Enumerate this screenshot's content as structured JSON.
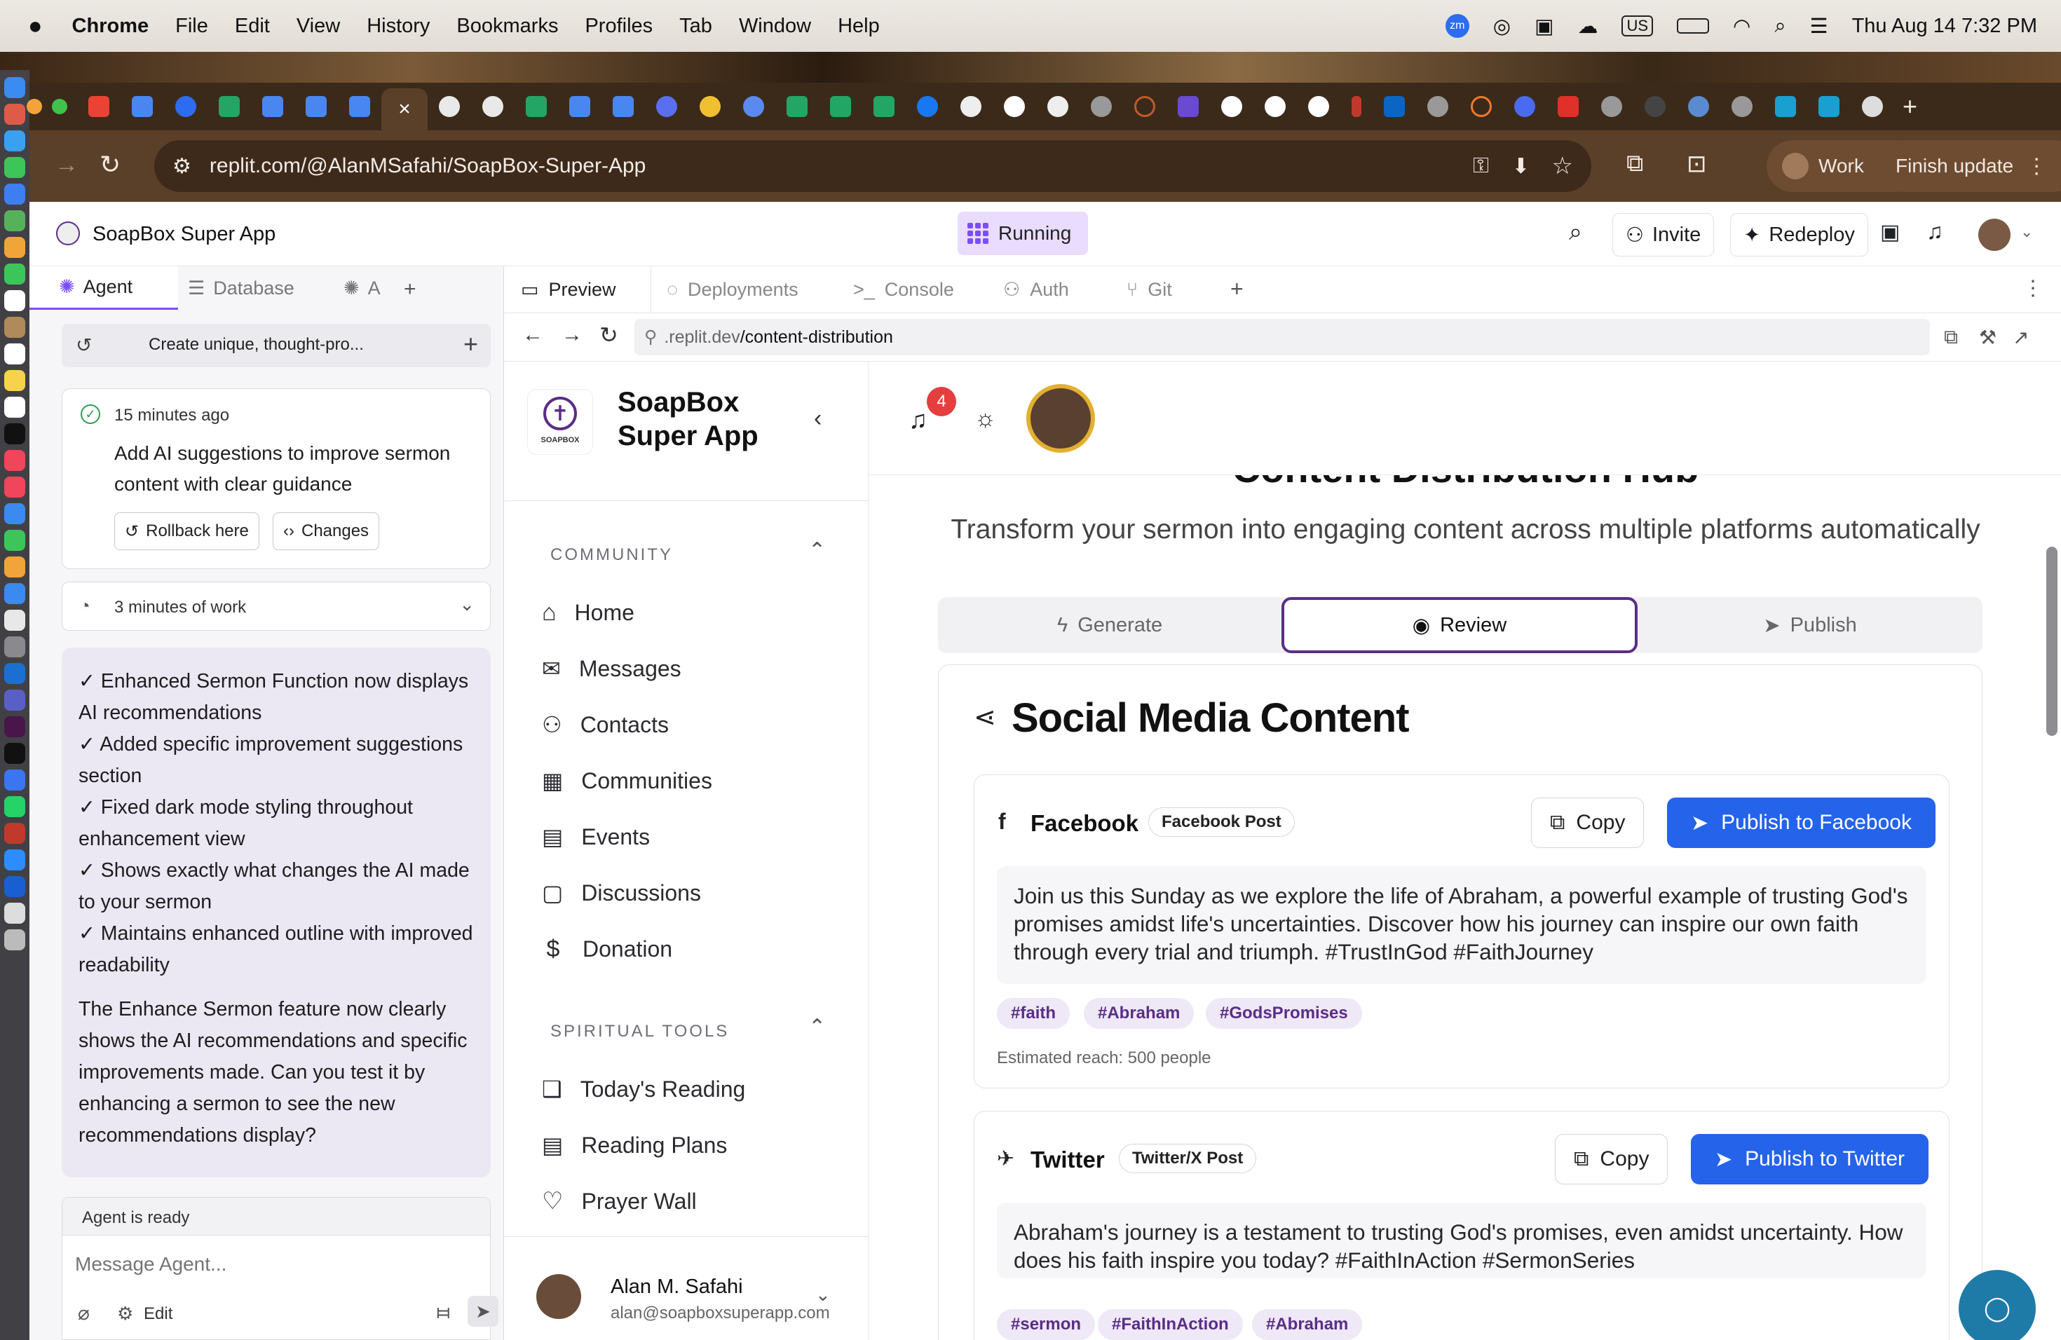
{
  "menubar": {
    "app": "Chrome",
    "items": [
      "File",
      "Edit",
      "View",
      "History",
      "Bookmarks",
      "Profiles",
      "Tab",
      "Window",
      "Help"
    ],
    "input_source": "US",
    "zoom_badge": "zm",
    "datetime": "Thu Aug 14  7:32 PM"
  },
  "browser": {
    "url": "replit.com/@AlanMSafahi/SoapBox-Super-App",
    "profile": "Work",
    "update_label": "Finish update",
    "active_tab_close": "×"
  },
  "replit": {
    "app_name": "SoapBox Super App",
    "status": "Running",
    "invite": "Invite",
    "redeploy": "Redeploy",
    "left_tabs": [
      "Agent",
      "Database",
      "A"
    ],
    "preview_tabs": [
      "Preview",
      "Deployments",
      "Console",
      "Auth",
      "Git"
    ],
    "preview_url_prefix": ".replit.dev",
    "preview_url_path": "/content-distribution"
  },
  "agent": {
    "thread_title": "Create unique, thought-pro...",
    "checkpoint_time": "15 minutes ago",
    "checkpoint_text": "Add AI suggestions to improve sermon content with clear guidance",
    "rollback": "Rollback here",
    "changes": "Changes",
    "work_summary": "3 minutes of work",
    "message_lines": [
      "✓ Enhanced Sermon Function now displays AI recommendations",
      "✓ Added specific improvement suggestions section",
      "✓ Fixed dark mode styling throughout enhancement view",
      "✓ Shows exactly what changes the AI made to your sermon",
      "✓ Maintains enhanced outline with improved readability"
    ],
    "message_paragraph": "The Enhance Sermon feature now clearly shows the AI recommendations and specific improvements made. Can you test it by enhancing a sermon to see the new recommendations display?",
    "status": "Agent is ready",
    "input_placeholder": "Message Agent...",
    "edit": "Edit"
  },
  "app": {
    "brand_line1": "SoapBox",
    "brand_line2": "Super App",
    "logo_text": "SOAPBOX",
    "notification_count": "4",
    "sections": [
      {
        "title": "COMMUNITY",
        "items": [
          "Home",
          "Messages",
          "Contacts",
          "Communities",
          "Events",
          "Discussions",
          "Donation"
        ]
      },
      {
        "title": "SPIRITUAL TOOLS",
        "items": [
          "Today's Reading",
          "Reading Plans",
          "Prayer Wall"
        ]
      }
    ],
    "user_name": "Alan M. Safahi",
    "user_email": "alan@soapboxsuperapp.com",
    "page_heading": "Content Distribution Hub",
    "page_subtitle": "Transform your sermon into engaging content across multiple platforms automatically",
    "steps": [
      "Generate",
      "Review",
      "Publish"
    ],
    "active_step": "Review",
    "card_title": "Social Media Content",
    "posts": [
      {
        "platform": "Facebook",
        "type": "Facebook Post",
        "copy": "Copy",
        "publish": "Publish to Facebook",
        "text": "Join us this Sunday as we explore the life of Abraham, a powerful example of trusting God's promises amidst life's uncertainties. Discover how his journey can inspire our own faith through every trial and triumph. #TrustInGod #FaithJourney",
        "tags": [
          "#faith",
          "#Abraham",
          "#GodsPromises"
        ],
        "reach": "Estimated reach: 500 people"
      },
      {
        "platform": "Twitter",
        "type": "Twitter/X Post",
        "copy": "Copy",
        "publish": "Publish to Twitter",
        "text": "Abraham's journey is a testament to trusting God's promises, even amidst uncertainty. How does his faith inspire you today? #FaithInAction #SermonSeries",
        "tags": [
          "#sermon",
          "#FaithInAction",
          "#Abraham"
        ]
      }
    ]
  },
  "colors": {
    "accent_purple": "#5a2d86",
    "publish_blue": "#2563eb",
    "running_bg": "#e9dcff",
    "notification_red": "#e53e3e"
  }
}
